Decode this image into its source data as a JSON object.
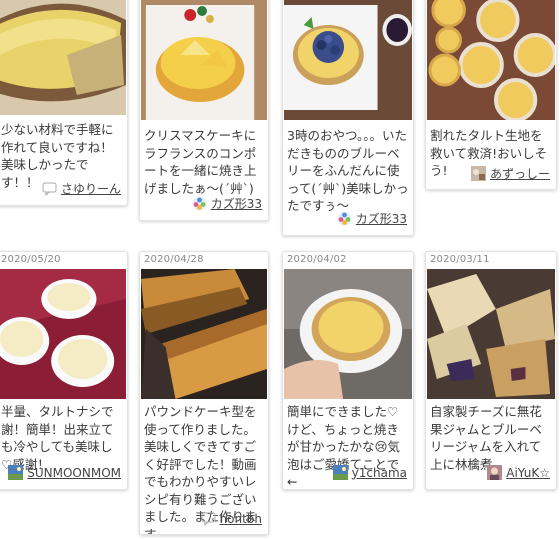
{
  "cards": [
    {
      "date": "",
      "text": "少ない材料で手軽に作れて良いですね！美味しかったです！！",
      "user": "さゆりーん",
      "avatar_icon": "speech-bubble-icon"
    },
    {
      "date": "",
      "text": "クリスマスケーキにラフランスのコンポートを一緒に焼き上げましたぁ〜(´艸`)",
      "user": "カズ形33",
      "avatar_icon": "flower-avatar-icon"
    },
    {
      "date": "",
      "text": "3時のおやつ。。。いただきもののブルーベリーをふんだんに使って(´艸`)美味しかったですぅ〜",
      "user": "カズ形33",
      "avatar_icon": "flower-avatar-icon"
    },
    {
      "date": "",
      "text": "割れたタルト生地を救いて救済!おいしそう!",
      "user": "あずっしー",
      "avatar_icon": "photo-avatar-icon"
    },
    {
      "date": "2020/05/20",
      "text": "半量、タルトナシで謝！簡単！出来立ても冷やしても美味し♡感謝！",
      "user": "SUNMOONMOM",
      "avatar_icon": "landscape-avatar-icon"
    },
    {
      "date": "2020/04/28",
      "text": "パウンドケーキ型を使って作りました。美味しくできてすごく好評でした！動画でもわかりやすいレシピ有り難うございました。また作ります",
      "user": "nontbh",
      "avatar_icon": "speech-bubble-icon"
    },
    {
      "date": "2020/04/02",
      "text": "簡単にできました♡けど、ちょっと焼きが甘かったかな😢気泡はご愛嬌てことで←",
      "user": "y1chama",
      "avatar_icon": "landscape-avatar-icon"
    },
    {
      "date": "2020/03/11",
      "text": "自家製チーズに無花果ジャムとブルーベリージャムを入れて上に林檎煮",
      "user": "AiYuK☆",
      "avatar_icon": "photo-avatar-icon"
    }
  ],
  "colors": {
    "card_border": "#e3e3e3",
    "date_text": "#888888",
    "body_text": "#3a3a3a"
  }
}
